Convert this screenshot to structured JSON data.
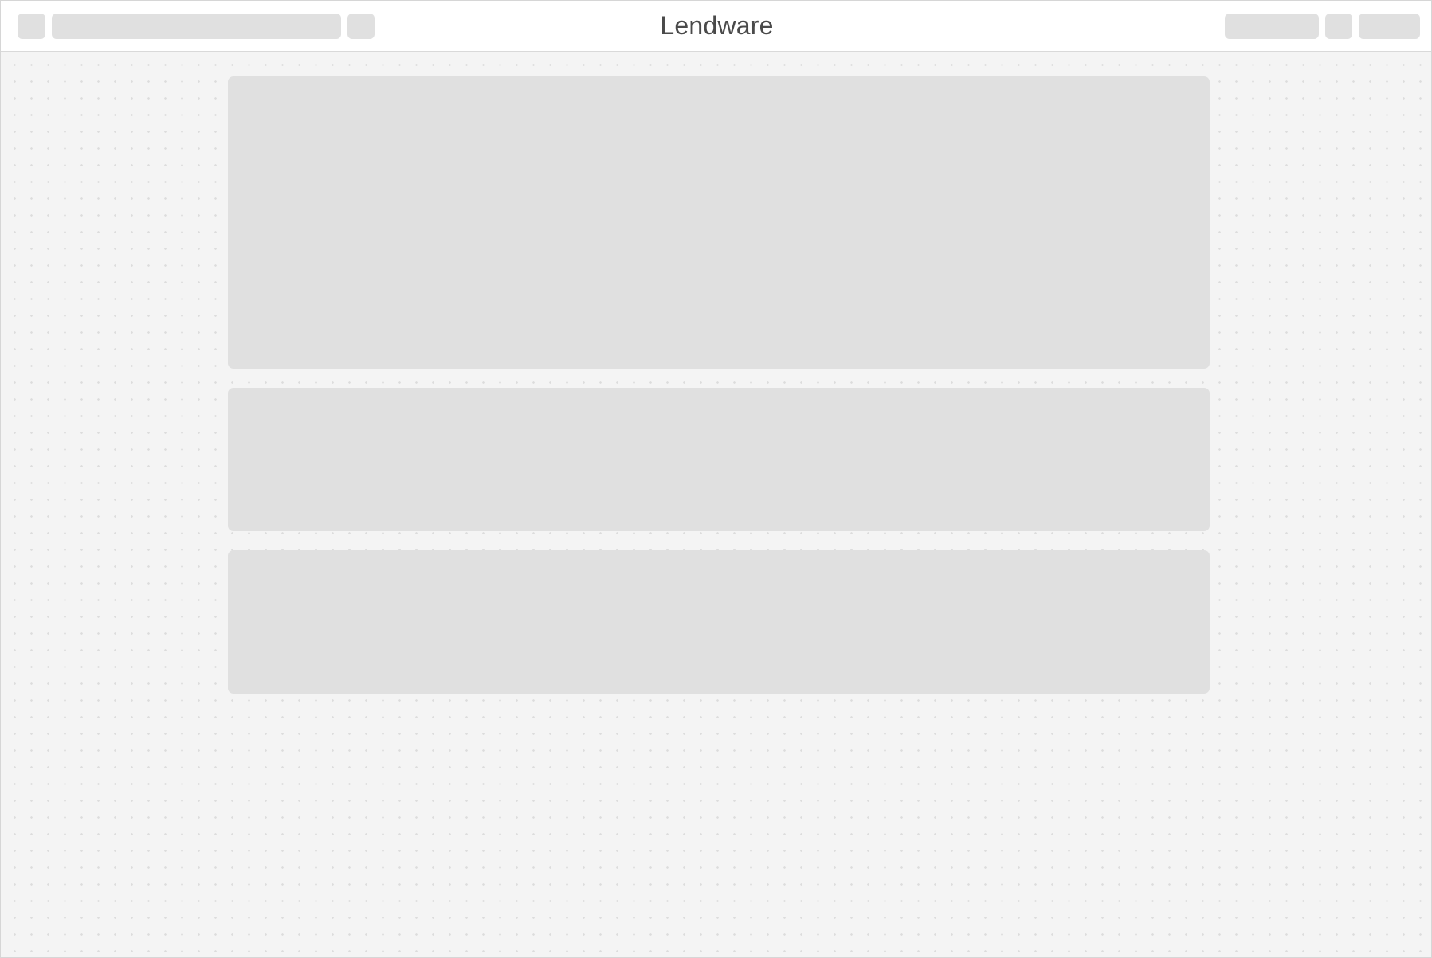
{
  "header": {
    "title": "Lendware"
  }
}
